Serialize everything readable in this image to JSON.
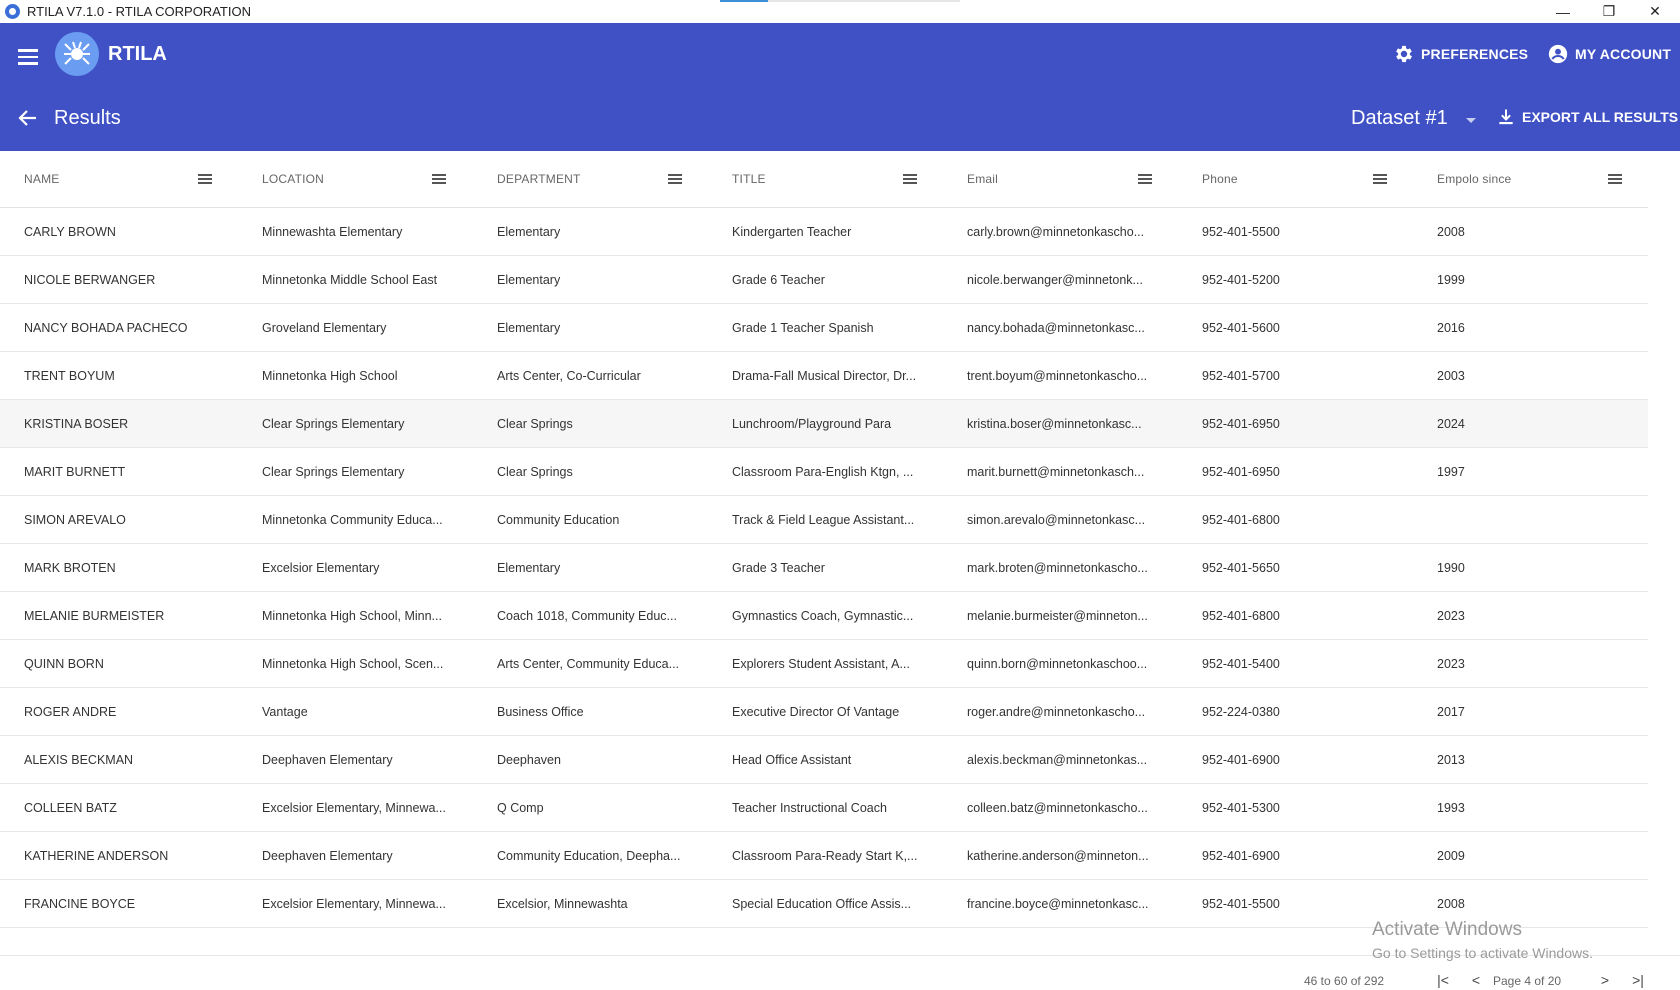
{
  "window": {
    "title": "RTILA V7.1.0 - RTILA CORPORATION",
    "minimize": "—",
    "maximize": "❐",
    "close": "✕"
  },
  "header": {
    "brand": "RTILA",
    "preferences": "PREFERENCES",
    "account": "MY ACCOUNT"
  },
  "subheader": {
    "title": "Results",
    "dataset": "Dataset #1",
    "export": "EXPORT ALL RESULTS"
  },
  "table": {
    "columns": [
      "NAME",
      "LOCATION",
      "DEPARTMENT",
      "TITLE",
      "Email",
      "Phone",
      "Empolo since"
    ],
    "rows": [
      [
        "CARLY BROWN",
        "Minnewashta Elementary",
        "Elementary",
        "Kindergarten Teacher",
        "carly.brown@minnetonkascho...",
        "952-401-5500",
        "2008"
      ],
      [
        "NICOLE BERWANGER",
        "Minnetonka Middle School East",
        "Elementary",
        "Grade 6 Teacher",
        "nicole.berwanger@minnetonk...",
        "952-401-5200",
        "1999"
      ],
      [
        "NANCY BOHADA PACHECO",
        "Groveland Elementary",
        "Elementary",
        "Grade 1 Teacher Spanish",
        "nancy.bohada@minnetonkasc...",
        "952-401-5600",
        "2016"
      ],
      [
        "TRENT BOYUM",
        "Minnetonka High School",
        "Arts Center, Co-Curricular",
        "Drama-Fall Musical Director, Dr...",
        "trent.boyum@minnetonkascho...",
        "952-401-5700",
        "2003"
      ],
      [
        "KRISTINA BOSER",
        "Clear Springs Elementary",
        "Clear Springs",
        "Lunchroom/Playground Para",
        "kristina.boser@minnetonkasc...",
        "952-401-6950",
        "2024"
      ],
      [
        "MARIT BURNETT",
        "Clear Springs Elementary",
        "Clear Springs",
        "Classroom Para-English Ktgn, ...",
        "marit.burnett@minnetonkasch...",
        "952-401-6950",
        "1997"
      ],
      [
        "SIMON AREVALO",
        "Minnetonka Community Educa...",
        "Community Education",
        "Track & Field League Assistant...",
        "simon.arevalo@minnetonkasc...",
        "952-401-6800",
        ""
      ],
      [
        "MARK BROTEN",
        "Excelsior Elementary",
        "Elementary",
        "Grade 3 Teacher",
        "mark.broten@minnetonkascho...",
        "952-401-5650",
        "1990"
      ],
      [
        "MELANIE BURMEISTER",
        "Minnetonka High School, Minn...",
        "Coach 1018, Community Educ...",
        "Gymnastics Coach, Gymnastic...",
        "melanie.burmeister@minneton...",
        "952-401-6800",
        "2023"
      ],
      [
        "QUINN BORN",
        "Minnetonka High School, Scen...",
        "Arts Center, Community Educa...",
        "Explorers Student Assistant, A...",
        "quinn.born@minnetonkaschoo...",
        "952-401-5400",
        "2023"
      ],
      [
        "ROGER ANDRE",
        "Vantage",
        "Business Office",
        "Executive Director Of Vantage",
        "roger.andre@minnetonkascho...",
        "952-224-0380",
        "2017"
      ],
      [
        "ALEXIS BECKMAN",
        "Deephaven Elementary",
        "Deephaven",
        "Head Office Assistant",
        "alexis.beckman@minnetonkas...",
        "952-401-6900",
        "2013"
      ],
      [
        "COLLEEN BATZ",
        "Excelsior Elementary, Minnewa...",
        "Q Comp",
        "Teacher Instructional Coach",
        "colleen.batz@minnetonkascho...",
        "952-401-5300",
        "1993"
      ],
      [
        "KATHERINE ANDERSON",
        "Deephaven Elementary",
        "Community Education, Deepha...",
        "Classroom Para-Ready Start K,...",
        "katherine.anderson@minneton...",
        "952-401-6900",
        "2009"
      ],
      [
        "FRANCINE BOYCE",
        "Excelsior Elementary, Minnewa...",
        "Excelsior, Minnewashta",
        "Special Education Office Assis...",
        "francine.boyce@minnetonkasc...",
        "952-401-5500",
        "2008"
      ]
    ]
  },
  "pagination": {
    "range": "46 to 60 of 292",
    "page_label": "Page  4  of  20",
    "first": "|<",
    "prev": "<",
    "next": ">",
    "last": ">|"
  },
  "watermark": {
    "line1": "Activate Windows",
    "line2": "Go to Settings to activate Windows."
  },
  "icons": {
    "menu": "hamburger-icon",
    "logo": "spider-logo-icon",
    "preferences": "gear-icon",
    "account": "account-circle-icon",
    "back": "arrow-left-icon",
    "export": "download-icon",
    "column_menu": "column-menu-icon"
  },
  "colors": {
    "appbar": "#3f51c4",
    "logo_bg": "#6a9df2"
  }
}
